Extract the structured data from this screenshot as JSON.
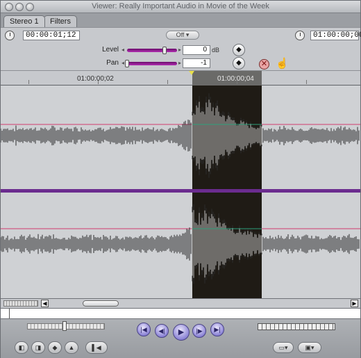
{
  "window": {
    "title": "Viewer: Really Important Audio in Movie of the Week"
  },
  "tabs": [
    {
      "label": "Stereo 1",
      "active": true
    },
    {
      "label": "Filters",
      "active": false
    }
  ],
  "header": {
    "current_timecode": "00:00:01;12",
    "duration_timecode": "01:00:00;00",
    "off_label": "Off",
    "level": {
      "label": "Level",
      "value": "0",
      "unit": "dB",
      "slider_fraction": 0.75
    },
    "pan": {
      "label": "Pan",
      "value": "-1",
      "slider_fraction": 0.0
    }
  },
  "ruler": {
    "labels": [
      "01:00:00;02",
      "01:00:00;04"
    ]
  },
  "waveform": {
    "level_line_color": "#d23a6e",
    "keyframe_line_color": "#2e9f7c",
    "divider_color": "#6b2c8f",
    "selection_color": "#1f1b15"
  },
  "icons": {
    "clock": "clock-icon",
    "keyframe": "keyframe-diamond-icon",
    "clear": "x-icon",
    "hand": "hand-grab-icon",
    "transport": [
      "go-to-in-icon",
      "step-back-icon",
      "play-icon",
      "step-forward-icon",
      "go-to-out-icon"
    ],
    "mark": [
      "mark-in-icon",
      "mark-out-icon",
      "add-keyframe-icon",
      "mark-clip-icon",
      "match-frame-icon"
    ]
  }
}
